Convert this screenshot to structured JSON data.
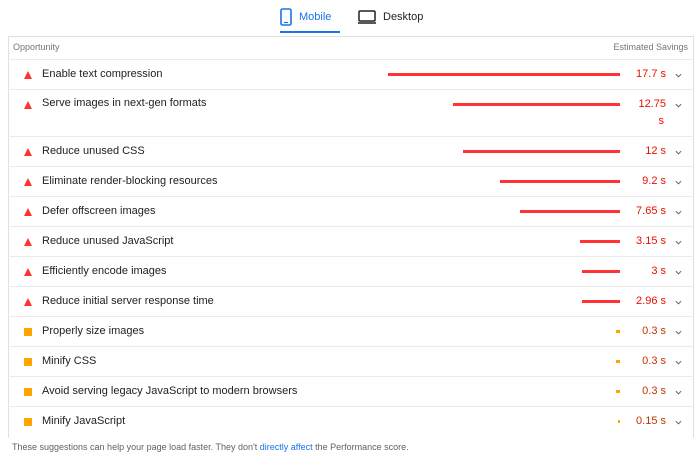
{
  "tabs": {
    "mobile_label": "Mobile",
    "desktop_label": "Desktop"
  },
  "header": {
    "left": "Opportunity",
    "right": "Estimated Savings"
  },
  "opportunities": [
    {
      "title": "Enable text compression",
      "savings": "17.7 s",
      "severity": "fail"
    },
    {
      "title": "Serve images in next-gen formats",
      "savings": "12.75 s",
      "savings_line1": "12.75",
      "savings_line2": "s",
      "severity": "fail"
    },
    {
      "title": "Reduce unused CSS",
      "savings": "12 s",
      "severity": "fail"
    },
    {
      "title": "Eliminate render-blocking resources",
      "savings": "9.2 s",
      "severity": "fail"
    },
    {
      "title": "Defer offscreen images",
      "savings": "7.65 s",
      "severity": "fail"
    },
    {
      "title": "Reduce unused JavaScript",
      "savings": "3.15 s",
      "severity": "fail"
    },
    {
      "title": "Efficiently encode images",
      "savings": "3 s",
      "severity": "fail"
    },
    {
      "title": "Reduce initial server response time",
      "savings": "2.96 s",
      "severity": "fail"
    },
    {
      "title": "Properly size images",
      "savings": "0.3 s",
      "severity": "average"
    },
    {
      "title": "Minify CSS",
      "savings": "0.3 s",
      "severity": "average"
    },
    {
      "title": "Avoid serving legacy JavaScript to modern browsers",
      "savings": "0.3 s",
      "severity": "average"
    },
    {
      "title": "Minify JavaScript",
      "savings": "0.15 s",
      "severity": "average"
    }
  ],
  "footer": {
    "text_before": "These suggestions can help your page load faster. They don't ",
    "link": "directly affect",
    "text_after": " the Performance score."
  },
  "colors": {
    "accent": "#1a73e8",
    "fail": "#ff3333",
    "average": "#ffa400"
  }
}
